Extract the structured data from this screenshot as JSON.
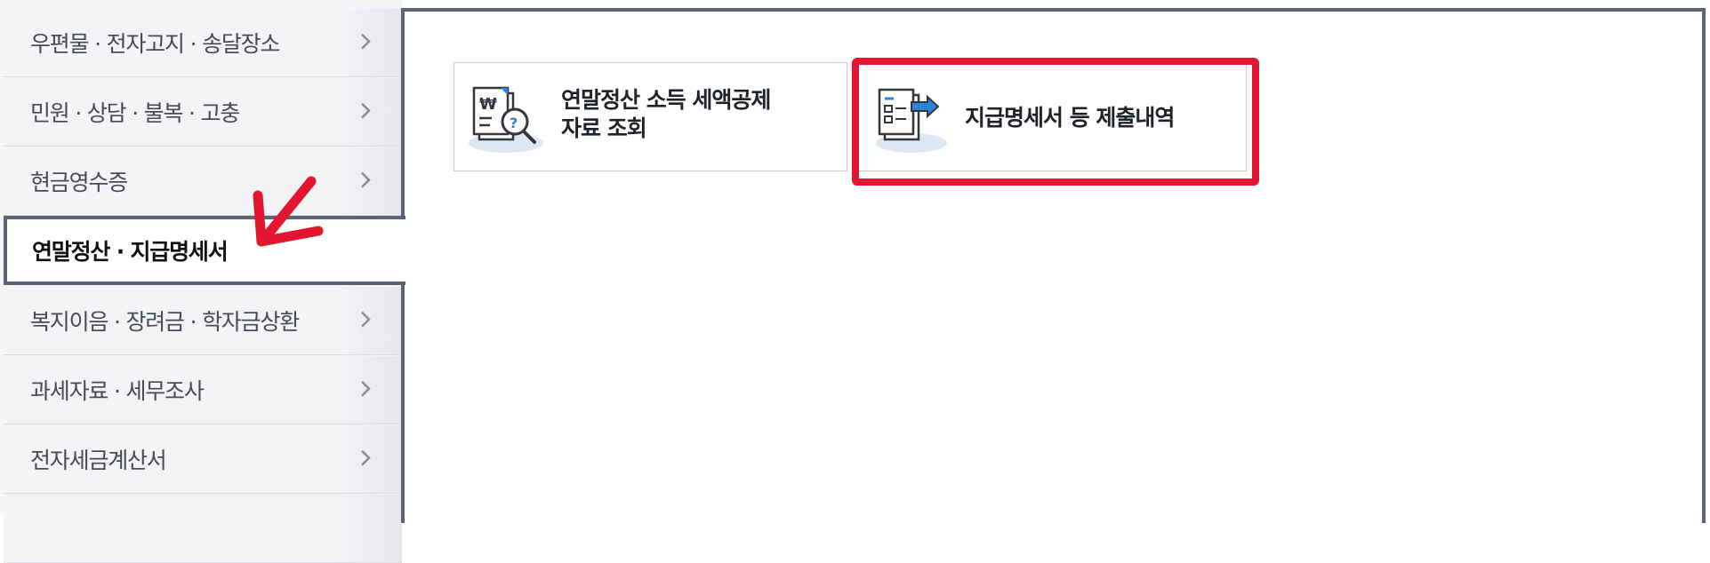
{
  "sidebar": {
    "items": [
      {
        "label": "우편물 · 전자고지 · 송달장소"
      },
      {
        "label": "민원 · 상담 · 불복 · 고충"
      },
      {
        "label": "현금영수증"
      },
      {
        "label": "연말정산 · 지급명세서"
      },
      {
        "label": "복지이음 · 장려금 · 학자금상환"
      },
      {
        "label": "과세자료 · 세무조사"
      },
      {
        "label": "전자세금계산서"
      }
    ],
    "active_index": 3
  },
  "main": {
    "cards": [
      {
        "line1": "연말정산 소득 세액공제",
        "line2": "자료 조회",
        "icon": "document-search-icon"
      },
      {
        "line1": "지급명세서 등 제출내역",
        "icon": "document-submit-icon"
      }
    ]
  },
  "colors": {
    "highlight": "#e3152f",
    "active_border": "#5b6477",
    "icon_blue": "#2a86d8"
  }
}
